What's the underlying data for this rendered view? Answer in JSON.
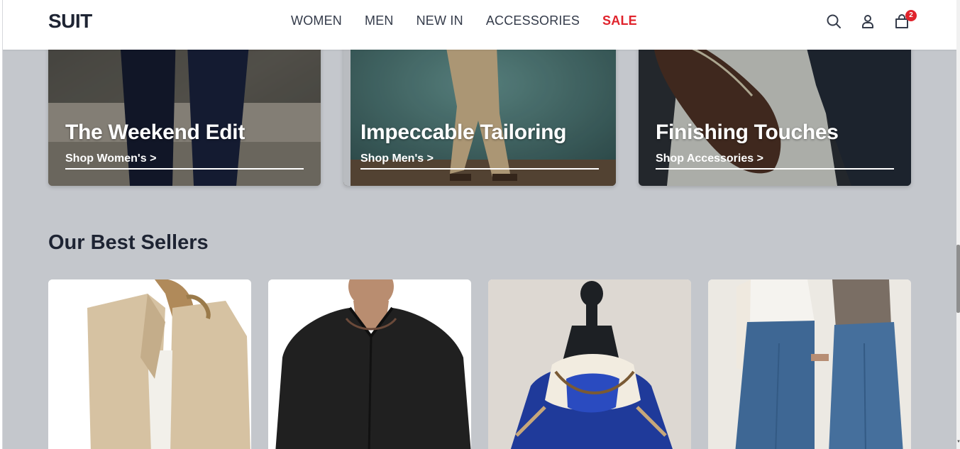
{
  "header": {
    "logo": "SUIT",
    "nav": [
      {
        "label": "WOMEN"
      },
      {
        "label": "MEN"
      },
      {
        "label": "NEW IN"
      },
      {
        "label": "ACCESSORIES"
      },
      {
        "label": "SALE"
      }
    ],
    "cart_count": "2"
  },
  "categories": [
    {
      "title": "The Weekend Edit",
      "link": "Shop Women's >"
    },
    {
      "title": "Impeccable Tailoring",
      "link": "Shop Men's >"
    },
    {
      "title": "Finishing Touches",
      "link": "Shop Accessories >"
    }
  ],
  "best_sellers": {
    "title": "Our Best Sellers"
  },
  "colors": {
    "brand_text": "#1e2433",
    "sale": "#e0232c",
    "page_bg": "#c4c7cc"
  }
}
